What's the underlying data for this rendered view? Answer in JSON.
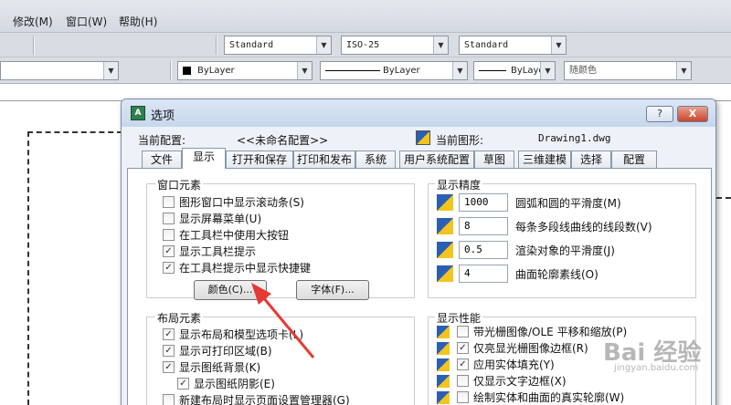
{
  "menu": {
    "items": [
      "修改(M)",
      "窗口(W)",
      "帮助(H)"
    ]
  },
  "toolbar1": {
    "text_style": "Standard",
    "dim_style": "ISO-25",
    "table_style": "Standard"
  },
  "toolbar2": {
    "color": "ByLayer",
    "linetype": "ByLayer",
    "lineweight": "ByLayer",
    "plot_style": "随颜色"
  },
  "dialog": {
    "title": "选项",
    "help_label": "?",
    "close_label": "X",
    "profile_label": "当前配置:",
    "profile_value": "<<未命名配置>>",
    "drawing_label": "当前图形:",
    "drawing_value": "Drawing1.dwg",
    "tabs": [
      "文件",
      "显示",
      "打开和保存",
      "打印和发布",
      "系统",
      "用户系统配置",
      "草图",
      "三维建模",
      "选择",
      "配置"
    ],
    "active_tab": "显示",
    "window_elements": {
      "title": "窗口元素",
      "items": [
        {
          "label": "图形窗口中显示滚动条(S)",
          "checked": false
        },
        {
          "label": "显示屏幕菜单(U)",
          "checked": false
        },
        {
          "label": "在工具栏中使用大按钮",
          "checked": false
        },
        {
          "label": "显示工具栏提示",
          "checked": true
        },
        {
          "label": "在工具栏提示中显示快捷键",
          "checked": true
        }
      ],
      "colors_button": "颜色(C)...",
      "fonts_button": "字体(F)..."
    },
    "layout_elements": {
      "title": "布局元素",
      "items": [
        {
          "label": "显示布局和模型选项卡(L)",
          "checked": true
        },
        {
          "label": "显示可打印区域(B)",
          "checked": true
        },
        {
          "label": "显示图纸背景(K)",
          "checked": true
        },
        {
          "label": "显示图纸阴影(E)",
          "checked": true
        },
        {
          "label": "新建布局时显示页面设置管理器(G)",
          "checked": false
        }
      ]
    },
    "display_resolution": {
      "title": "显示精度",
      "items": [
        {
          "value": "1000",
          "label": "圆弧和圆的平滑度(M)"
        },
        {
          "value": "8",
          "label": "每条多段线曲线的线段数(V)"
        },
        {
          "value": "0.5",
          "label": "渲染对象的平滑度(J)"
        },
        {
          "value": "4",
          "label": "曲面轮廓素线(O)"
        }
      ]
    },
    "display_performance": {
      "title": "显示性能",
      "items": [
        {
          "label": "带光栅图像/OLE 平移和缩放(P)",
          "checked": false
        },
        {
          "label": "仅亮显光栅图像边框(R)",
          "checked": true
        },
        {
          "label": "应用实体填充(Y)",
          "checked": true
        },
        {
          "label": "仅显示文字边框(X)",
          "checked": false
        },
        {
          "label": "绘制实体和曲面的真实轮廓(W)",
          "checked": false
        }
      ]
    }
  },
  "watermark": {
    "text": "Bai 经验",
    "subtext": "jingyan.baidu.com"
  },
  "colors": {
    "arrow": "#e53935",
    "dialog_bg": "#eef2f8",
    "titlebar": "#c6d6ec"
  }
}
